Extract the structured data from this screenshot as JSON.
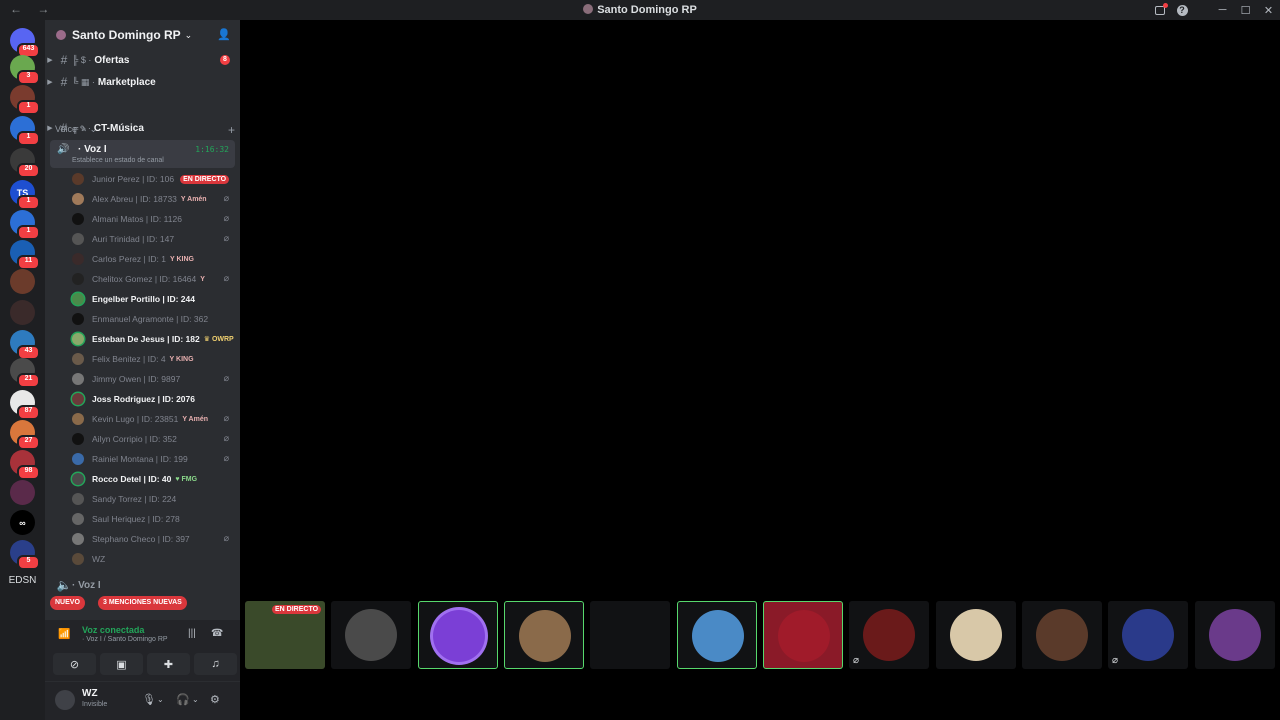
{
  "window": {
    "title": "Santo Domingo RP",
    "nav": "← →"
  },
  "titlebar_icons": [
    "inbox-icon",
    "help-icon",
    "minimize-icon",
    "maximize-icon",
    "close-icon"
  ],
  "servers": [
    {
      "label": "",
      "badge": "643",
      "color": "#5865f2"
    },
    {
      "label": "",
      "badge": "3",
      "color": "#6aa84f"
    },
    {
      "label": "",
      "badge": "1",
      "color": "#7a3b2e"
    },
    {
      "label": "",
      "badge": "1",
      "color": "#2c6fd6"
    },
    {
      "label": "",
      "badge": "20",
      "color": "#3a3a3a"
    },
    {
      "label": "TS",
      "badge": "1",
      "color": "#1e4fd1"
    },
    {
      "label": "",
      "badge": "1",
      "color": "#2c6fd6"
    },
    {
      "label": "",
      "badge": "11",
      "color": "#1a5fb4"
    },
    {
      "label": "",
      "badge": "",
      "color": "#6b3b2b"
    },
    {
      "label": "",
      "badge": "",
      "color": "#3a2a2a"
    },
    {
      "label": "",
      "badge": "43",
      "color": "#2e7bbf"
    },
    {
      "label": "",
      "badge": "21",
      "color": "#4a4a4a"
    },
    {
      "label": "",
      "badge": "87",
      "color": "#e8e8e8"
    },
    {
      "label": "",
      "badge": "27",
      "color": "#d9773c"
    },
    {
      "label": "",
      "badge": "98",
      "color": "#a8323a"
    },
    {
      "label": "",
      "badge": "",
      "color": "#5a2a4a"
    },
    {
      "label": "∞",
      "badge": "",
      "color": "#000000"
    },
    {
      "label": "",
      "badge": "5",
      "color": "#2a3f8a"
    }
  ],
  "rail_text": "EDSN",
  "guild": {
    "name": "Santo Domingo RP"
  },
  "channels": [
    {
      "label": "Ofertas",
      "deco": "╠ $ ·",
      "mention": "8"
    },
    {
      "label": "Marketplace",
      "deco": "╚ ▦ ·",
      "mention": ""
    }
  ],
  "category": {
    "label": "Voice"
  },
  "ct_channel": {
    "label": "CT-Música",
    "deco": "╔ ♪ ·"
  },
  "voice_active": {
    "name": "· Voz I",
    "timer": "1:16:32",
    "status": "Establece un estado de canal"
  },
  "members": [
    {
      "name": "Junior Perez | ID: 106",
      "speaking": false,
      "tag": "",
      "tag_color": "",
      "live": "EN DIRECTO",
      "muted": false
    },
    {
      "name": "Alex Abreu | ID: 18733",
      "speaking": false,
      "tag": "Y Amén",
      "tag_color": "r",
      "live": "",
      "muted": true
    },
    {
      "name": "Almani Matos | ID: 1126",
      "speaking": false,
      "tag": "",
      "tag_color": "",
      "live": "",
      "muted": true
    },
    {
      "name": "Auri Trinidad | ID: 147",
      "speaking": false,
      "tag": "",
      "tag_color": "",
      "live": "",
      "muted": true
    },
    {
      "name": "Carlos Perez | ID: 1",
      "speaking": false,
      "tag": "Y KING",
      "tag_color": "r",
      "live": "",
      "muted": false
    },
    {
      "name": "Chelitox Gomez | ID: 16464",
      "speaking": false,
      "tag": "Y",
      "tag_color": "r",
      "live": "",
      "muted": true
    },
    {
      "name": "Engelber Portillo | ID: 244",
      "speaking": true,
      "tag": "",
      "tag_color": "",
      "live": "",
      "muted": false
    },
    {
      "name": "Enmanuel Agramonte | ID: 362",
      "speaking": false,
      "tag": "",
      "tag_color": "",
      "live": "",
      "muted": false
    },
    {
      "name": "Esteban De Jesus | ID: 182",
      "speaking": true,
      "tag": "♛ OWRP",
      "tag_color": "y",
      "live": "",
      "muted": false
    },
    {
      "name": "Felix Benitez | ID: 4",
      "speaking": false,
      "tag": "Y KING",
      "tag_color": "r",
      "live": "",
      "muted": false
    },
    {
      "name": "Jimmy Owen | ID: 9897",
      "speaking": false,
      "tag": "",
      "tag_color": "",
      "live": "",
      "muted": true
    },
    {
      "name": "Joss Rodriguez | ID: 2076",
      "speaking": true,
      "tag": "",
      "tag_color": "",
      "live": "",
      "muted": false
    },
    {
      "name": "Kevin Lugo | ID: 23851",
      "speaking": false,
      "tag": "Y Amén",
      "tag_color": "r",
      "live": "",
      "muted": true
    },
    {
      "name": "Ailyn Corripio | ID: 352",
      "speaking": false,
      "tag": "",
      "tag_color": "",
      "live": "",
      "muted": true
    },
    {
      "name": "Rainiel Montana | ID: 199",
      "speaking": false,
      "tag": "",
      "tag_color": "",
      "live": "",
      "muted": true
    },
    {
      "name": "Rocco Detel | ID: 40",
      "speaking": true,
      "tag": "♥ FMG",
      "tag_color": "g",
      "live": "",
      "muted": false
    },
    {
      "name": "Sandy Torrez | ID: 224",
      "speaking": false,
      "tag": "",
      "tag_color": "",
      "live": "",
      "muted": false
    },
    {
      "name": "Saul Heriquez | ID: 278",
      "speaking": false,
      "tag": "",
      "tag_color": "",
      "live": "",
      "muted": false
    },
    {
      "name": "Stephano Checo | ID: 397",
      "speaking": false,
      "tag": "",
      "tag_color": "",
      "live": "",
      "muted": true
    },
    {
      "name": "WZ",
      "speaking": false,
      "tag": "",
      "tag_color": "",
      "live": "",
      "muted": false
    }
  ],
  "voice2": {
    "label": "· Voz I"
  },
  "pills": {
    "new": "NUEVO",
    "mentions": "3 MENCIONES NUEVAS"
  },
  "voice_connection": {
    "title": "Voz conectada",
    "sub": "· Voz I / Santo Domingo RP"
  },
  "user": {
    "name": "WZ",
    "status": "Invisible"
  },
  "stage_tiles": [
    {
      "color": "#3a4a2a",
      "selected": false,
      "live": "EN DIRECTO",
      "muted": false
    },
    {
      "color": "#4a4a4a",
      "selected": false,
      "live": "",
      "muted": false
    },
    {
      "color": "#7b3fd6",
      "selected": true,
      "live": "",
      "muted": false
    },
    {
      "color": "#8a6a4a",
      "selected": true,
      "live": "",
      "muted": false
    },
    {
      "color": "#111214",
      "selected": false,
      "live": "",
      "muted": false
    },
    {
      "color": "#4a8ac6",
      "selected": true,
      "live": "",
      "muted": false
    },
    {
      "color": "#a01b2a",
      "selected": true,
      "live": "",
      "muted": false
    },
    {
      "color": "#6a1a1a",
      "selected": false,
      "live": "",
      "muted": true
    },
    {
      "color": "#d8c8a8",
      "selected": false,
      "live": "",
      "muted": false
    },
    {
      "color": "#5a3a2a",
      "selected": false,
      "live": "",
      "muted": false
    },
    {
      "color": "#2a3a8a",
      "selected": false,
      "live": "",
      "muted": true
    },
    {
      "color": "#6a3a8a",
      "selected": false,
      "live": "",
      "muted": false
    }
  ]
}
